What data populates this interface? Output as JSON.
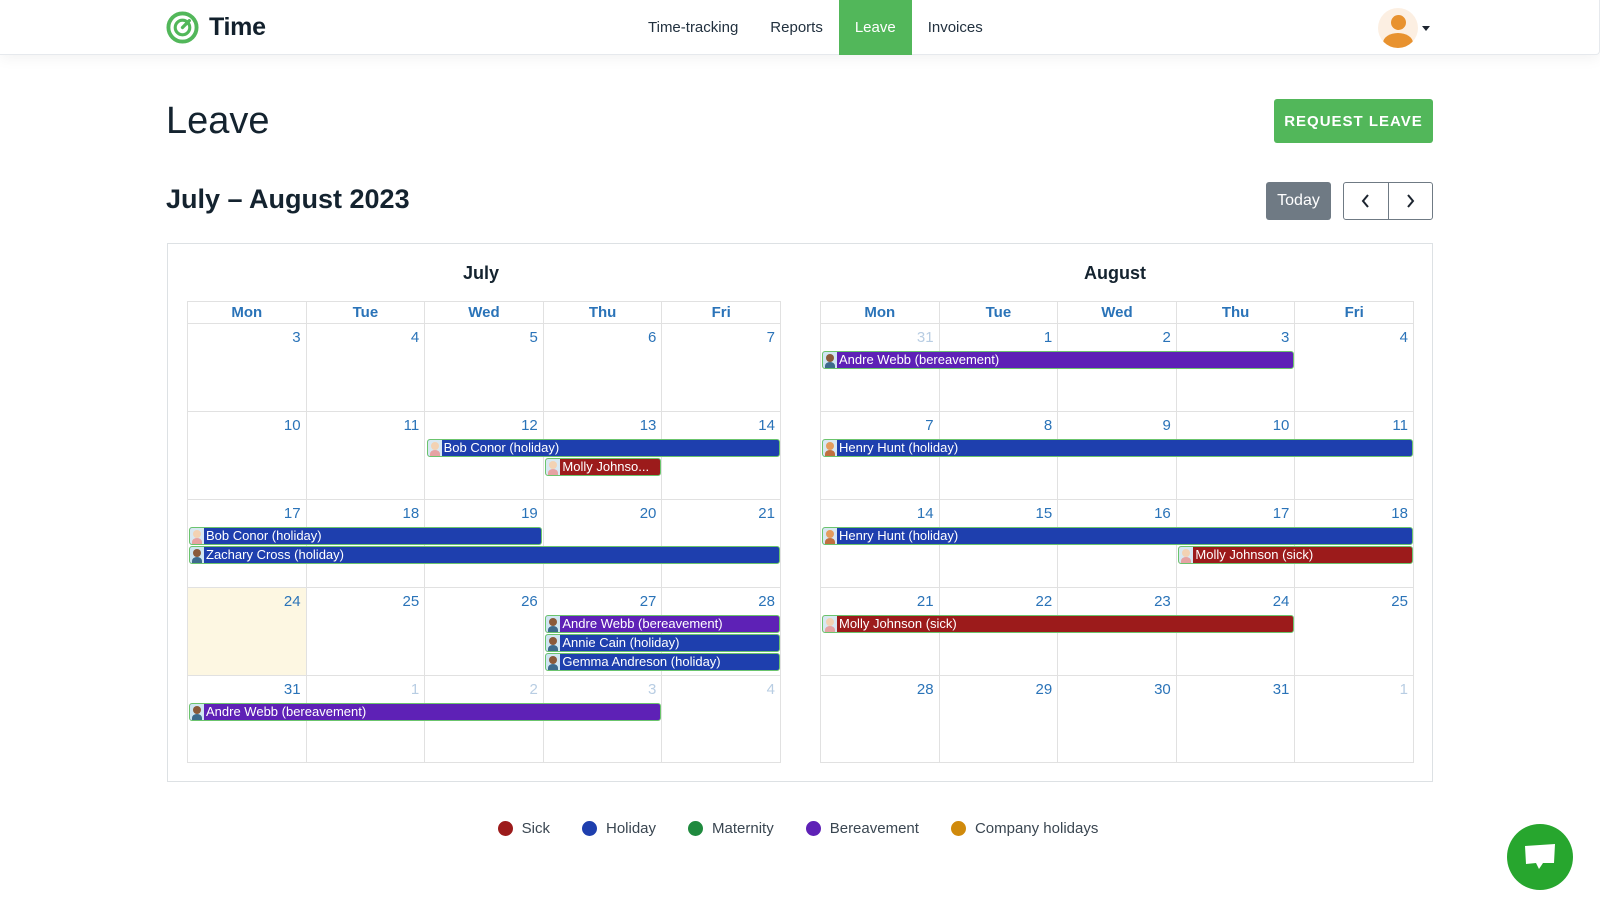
{
  "app": {
    "name": "Time"
  },
  "nav": {
    "items": [
      {
        "label": "Time-tracking",
        "active": false
      },
      {
        "label": "Reports",
        "active": false
      },
      {
        "label": "Leave",
        "active": true
      },
      {
        "label": "Invoices",
        "active": false
      }
    ]
  },
  "user": {
    "icon": "user-avatar-icon"
  },
  "page": {
    "title": "Leave",
    "request_button": "REQUEST LEAVE",
    "range_title": "July – August 2023",
    "today_button": "Today",
    "prev_icon": "chevron-left-icon",
    "next_icon": "chevron-right-icon"
  },
  "colors": {
    "brand": "#52b75a",
    "sick": "#9c1b1b",
    "holiday": "#1e3fae",
    "maternity": "#1f8a3e",
    "bereavement": "#5e21b6",
    "company": "#d08a0c"
  },
  "calendar": {
    "weekdays": [
      "Mon",
      "Tue",
      "Wed",
      "Thu",
      "Fri"
    ],
    "months": [
      {
        "name": "July",
        "weeks": [
          {
            "days": [
              {
                "n": "3"
              },
              {
                "n": "4"
              },
              {
                "n": "5"
              },
              {
                "n": "6"
              },
              {
                "n": "7"
              }
            ],
            "events": []
          },
          {
            "days": [
              {
                "n": "10"
              },
              {
                "n": "11"
              },
              {
                "n": "12"
              },
              {
                "n": "13"
              },
              {
                "n": "14"
              }
            ],
            "events": [
              {
                "label": "Bob Conor (holiday)",
                "type": "holiday",
                "start": 2,
                "end": 4,
                "lane": 0,
                "avatar": "light"
              },
              {
                "label": "Molly Johnso...",
                "type": "sick",
                "start": 3,
                "end": 3,
                "lane": 1,
                "avatar": "light"
              }
            ]
          },
          {
            "days": [
              {
                "n": "17"
              },
              {
                "n": "18"
              },
              {
                "n": "19"
              },
              {
                "n": "20"
              },
              {
                "n": "21"
              }
            ],
            "events": [
              {
                "label": "Bob Conor (holiday)",
                "type": "holiday",
                "start": 0,
                "end": 2,
                "lane": 0,
                "avatar": "light"
              },
              {
                "label": "Zachary Cross (holiday)",
                "type": "holiday",
                "start": 0,
                "end": 4,
                "lane": 1,
                "avatar": "dark"
              }
            ]
          },
          {
            "days": [
              {
                "n": "24",
                "today": true
              },
              {
                "n": "25"
              },
              {
                "n": "26"
              },
              {
                "n": "27"
              },
              {
                "n": "28"
              }
            ],
            "events": [
              {
                "label": "Andre Webb (bereavement)",
                "type": "bereavement",
                "start": 3,
                "end": 4,
                "lane": 0,
                "avatar": "dark"
              },
              {
                "label": "Annie Cain (holiday)",
                "type": "holiday",
                "start": 3,
                "end": 4,
                "lane": 1,
                "avatar": "dark"
              },
              {
                "label": "Gemma Andreson (holiday)",
                "type": "holiday",
                "start": 3,
                "end": 4,
                "lane": 2,
                "avatar": "dark"
              }
            ]
          },
          {
            "days": [
              {
                "n": "31"
              },
              {
                "n": "1",
                "other": true
              },
              {
                "n": "2",
                "other": true
              },
              {
                "n": "3",
                "other": true
              },
              {
                "n": "4",
                "other": true
              }
            ],
            "events": [
              {
                "label": "Andre Webb (bereavement)",
                "type": "bereavement",
                "start": 0,
                "end": 3,
                "lane": 0,
                "avatar": "dark"
              }
            ]
          }
        ]
      },
      {
        "name": "August",
        "weeks": [
          {
            "days": [
              {
                "n": "31",
                "other": true
              },
              {
                "n": "1"
              },
              {
                "n": "2"
              },
              {
                "n": "3"
              },
              {
                "n": "4"
              }
            ],
            "events": [
              {
                "label": "Andre Webb (bereavement)",
                "type": "bereavement",
                "start": 0,
                "end": 3,
                "lane": 0,
                "avatar": "dark"
              }
            ]
          },
          {
            "days": [
              {
                "n": "7"
              },
              {
                "n": "8"
              },
              {
                "n": "9"
              },
              {
                "n": "10"
              },
              {
                "n": "11"
              }
            ],
            "events": [
              {
                "label": "Henry Hunt (holiday)",
                "type": "holiday",
                "start": 0,
                "end": 4,
                "lane": 0,
                "avatar": "orange"
              }
            ]
          },
          {
            "days": [
              {
                "n": "14"
              },
              {
                "n": "15"
              },
              {
                "n": "16"
              },
              {
                "n": "17"
              },
              {
                "n": "18"
              }
            ],
            "events": [
              {
                "label": "Henry Hunt (holiday)",
                "type": "holiday",
                "start": 0,
                "end": 4,
                "lane": 0,
                "avatar": "orange"
              },
              {
                "label": "Molly Johnson (sick)",
                "type": "sick",
                "start": 3,
                "end": 4,
                "lane": 1,
                "avatar": "light"
              }
            ]
          },
          {
            "days": [
              {
                "n": "21"
              },
              {
                "n": "22"
              },
              {
                "n": "23"
              },
              {
                "n": "24"
              },
              {
                "n": "25"
              }
            ],
            "events": [
              {
                "label": "Molly Johnson (sick)",
                "type": "sick",
                "start": 0,
                "end": 3,
                "lane": 0,
                "avatar": "light"
              }
            ]
          },
          {
            "days": [
              {
                "n": "28"
              },
              {
                "n": "29"
              },
              {
                "n": "30"
              },
              {
                "n": "31"
              },
              {
                "n": "1",
                "other": true
              }
            ],
            "events": []
          }
        ]
      }
    ]
  },
  "legend": [
    {
      "label": "Sick",
      "type": "sick"
    },
    {
      "label": "Holiday",
      "type": "holiday"
    },
    {
      "label": "Maternity",
      "type": "maternity"
    },
    {
      "label": "Bereavement",
      "type": "bereavement"
    },
    {
      "label": "Company holidays",
      "type": "company"
    }
  ],
  "chat": {
    "icon": "chat-bubble-icon"
  }
}
